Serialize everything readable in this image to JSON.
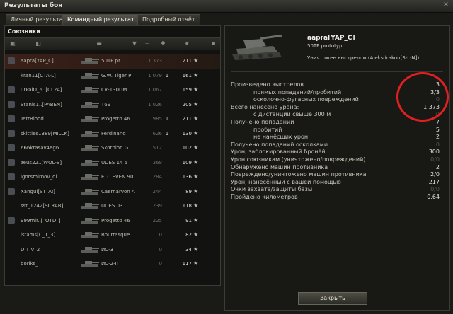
{
  "window": {
    "title": "Результаты боя"
  },
  "tabs": [
    {
      "label": "Личный результат"
    },
    {
      "label": "Командный результат"
    },
    {
      "label": "Подробный отчёт"
    }
  ],
  "allies": {
    "label": "Союзники",
    "rows": [
      {
        "name": "aapra[YAP_C]",
        "vehicle": "50TP pr.",
        "damage": "1 373",
        "kills": "",
        "xp": "211"
      },
      {
        "name": "kran11[CTA-L]",
        "vehicle": "G.W. Tiger P",
        "damage": "1 079",
        "kills": "1",
        "xp": "161"
      },
      {
        "name": "urPalO_6..[CL24]",
        "vehicle": "СУ-130ПМ",
        "damage": "1 067",
        "kills": "",
        "xp": "159"
      },
      {
        "name": "Stanis1..[PABEN]",
        "vehicle": "T69",
        "damage": "1 026",
        "kills": "",
        "xp": "205"
      },
      {
        "name": "TetrBlood",
        "vehicle": "Progetto 46",
        "damage": "985",
        "kills": "1",
        "xp": "211"
      },
      {
        "name": "skittles1389[MILLK]",
        "vehicle": "Ferdinand",
        "damage": "626",
        "kills": "1",
        "xp": "130"
      },
      {
        "name": "666krasav4eg6..",
        "vehicle": "Skorpion G",
        "damage": "512",
        "kills": "",
        "xp": "102"
      },
      {
        "name": "zeus22..[WOL-S]",
        "vehicle": "UDES 14 5",
        "damage": "368",
        "kills": "",
        "xp": "109"
      },
      {
        "name": "igorsmirnov_di..",
        "vehicle": "ELC EVEN 90",
        "damage": "284",
        "kills": "",
        "xp": "136"
      },
      {
        "name": "Xangul[ST_AI]",
        "vehicle": "Caernarvon A",
        "damage": "244",
        "kills": "",
        "xp": "89"
      },
      {
        "name": "sst_1242[SCRAB]",
        "vehicle": "UDES 03",
        "damage": "239",
        "kills": "",
        "xp": "118"
      },
      {
        "name": "999mir..[_OTD_]",
        "vehicle": "Progetto 46",
        "damage": "225",
        "kills": "",
        "xp": "91"
      },
      {
        "name": "istams[C_T_3]",
        "vehicle": "Bourrasque",
        "damage": "0",
        "kills": "",
        "xp": "82"
      },
      {
        "name": "D_I_V_2",
        "vehicle": "ИС-3",
        "damage": "0",
        "kills": "",
        "xp": "34"
      },
      {
        "name": "boriks_",
        "vehicle": "ИС-2-II",
        "damage": "0",
        "kills": "",
        "xp": "117"
      }
    ]
  },
  "player": {
    "title": "aapra[YAP_C]",
    "vehicle": "50TP prototyp",
    "killed_by": "Уничтожен выстрелом (Aleksdrakon[S-L-N])"
  },
  "stats": [
    {
      "label": "Произведено выстрелов",
      "value": "3",
      "indent": false,
      "dim": false
    },
    {
      "label": "прямых попаданий/пробитий",
      "value": "3/3",
      "indent": true,
      "dim": false
    },
    {
      "label": "осколочно-фугасных повреждений",
      "value": "0",
      "indent": true,
      "dim": true
    },
    {
      "label": "Всего нанесено урона:",
      "value": "1 373",
      "indent": false,
      "dim": false
    },
    {
      "label": "с дистанции свыше 300 м",
      "value": "0",
      "indent": true,
      "dim": true
    },
    {
      "label": "Получено попаданий",
      "value": "7",
      "indent": false,
      "dim": false
    },
    {
      "label": "пробитий",
      "value": "5",
      "indent": true,
      "dim": false
    },
    {
      "label": "не нанёсших урон",
      "value": "2",
      "indent": true,
      "dim": false
    },
    {
      "label": "Получено попаданий осколками",
      "value": "0",
      "indent": false,
      "dim": true
    },
    {
      "label": "Урон, заблокированный бронёй",
      "value": "300",
      "indent": false,
      "dim": false
    },
    {
      "label": "Урон союзникам (уничтожено/повреждений)",
      "value": "0/0",
      "indent": false,
      "dim": true
    },
    {
      "label": "Обнаружено машин противника",
      "value": "2",
      "indent": false,
      "dim": false
    },
    {
      "label": "Повреждено/уничтожено машин противника",
      "value": "2/0",
      "indent": false,
      "dim": false
    },
    {
      "label": "Урон, нанесённый с вашей помощью",
      "value": "217",
      "indent": false,
      "dim": false
    },
    {
      "label": "Очки захвата/защиты базы",
      "value": "0/0",
      "indent": false,
      "dim": true
    },
    {
      "label": "Пройдено километров",
      "value": "0,64",
      "indent": false,
      "dim": false
    }
  ],
  "buttons": {
    "close": "Закрыть"
  },
  "colors": {
    "accent_ring": "#e02020",
    "self_row": "#3a2018"
  }
}
